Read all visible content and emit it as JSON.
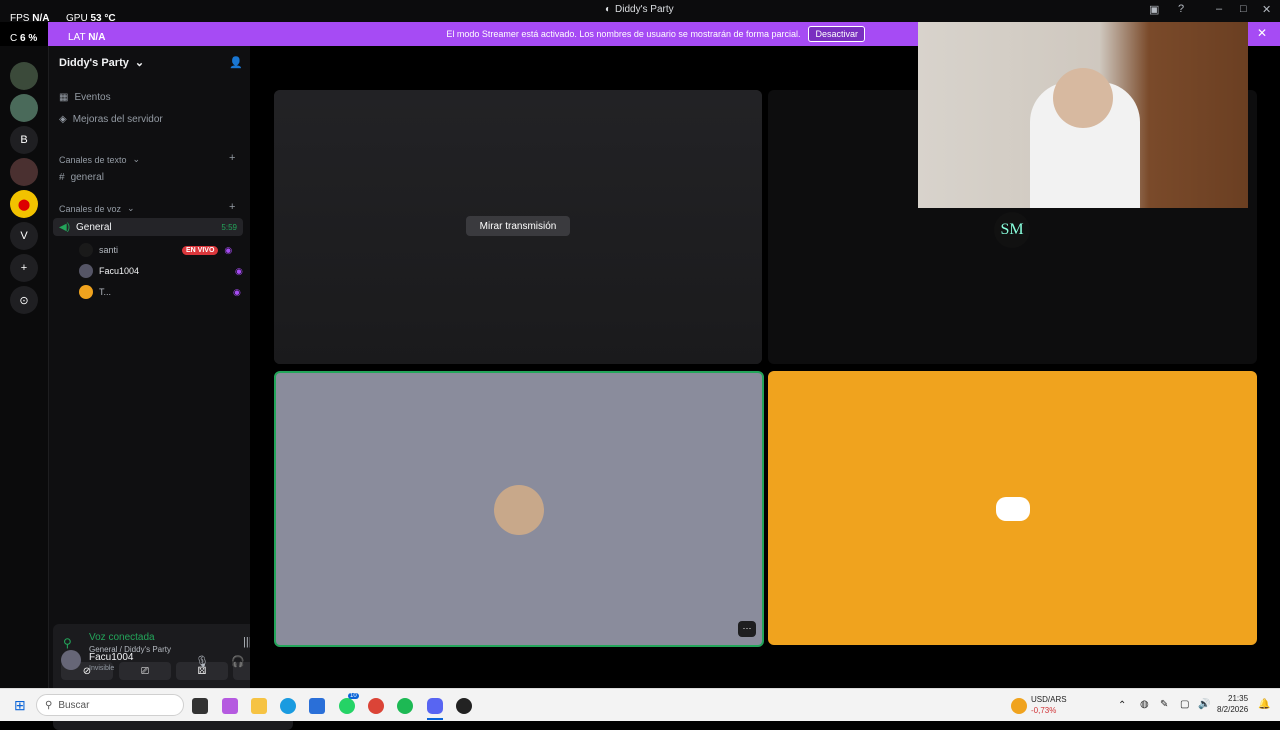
{
  "window": {
    "title": "Diddy's Party",
    "controls": [
      "–",
      "□",
      "✕"
    ]
  },
  "overlay": {
    "fps_label": "FPS",
    "fps_value": "N/A",
    "gpu_label": "GPU",
    "gpu_value": "53 °C",
    "cpu_label": "C",
    "cpu_value": "6 %",
    "lat_label": "LAT",
    "lat_value": "N/A"
  },
  "banner": {
    "text": "El modo Streamer está activado. Los nombres de usuario se mostrarán de forma parcial.",
    "button": "Desactivar"
  },
  "rail": {
    "letter_b": "B",
    "letter_v": "V",
    "add": "+",
    "explore": "⊙"
  },
  "server": {
    "name": "Diddy's Party"
  },
  "sidebar": {
    "events": "Eventos",
    "boost": "Mejoras del servidor",
    "text_category": "Canales de texto",
    "text_channel": "general",
    "voice_category": "Canales de voz",
    "voice_channel": "General",
    "voice_timer": "5:59",
    "users": [
      {
        "name": "santi",
        "badge": "EN VIVO"
      },
      {
        "name": "Facu1004"
      },
      {
        "name": "T..."
      }
    ]
  },
  "voice": {
    "status": "Voz conectada",
    "location": "General / Diddy's Party"
  },
  "user": {
    "name": "Facu1004",
    "status": "Invisible"
  },
  "stream": {
    "watch_button": "Mirar transmisión"
  },
  "webcam": {
    "watermark": "SM"
  },
  "taskbar": {
    "search_placeholder": "Buscar",
    "ticker": "USD/ARS",
    "ticker_change": "-0,73%",
    "time": "21:35",
    "date": "8/2/2026",
    "whatsapp_badge": "10"
  },
  "colors": {
    "accent": "#a64bf4",
    "speaking": "#23a55a",
    "orange_tile": "#f0a31e",
    "live": "#da373c"
  }
}
